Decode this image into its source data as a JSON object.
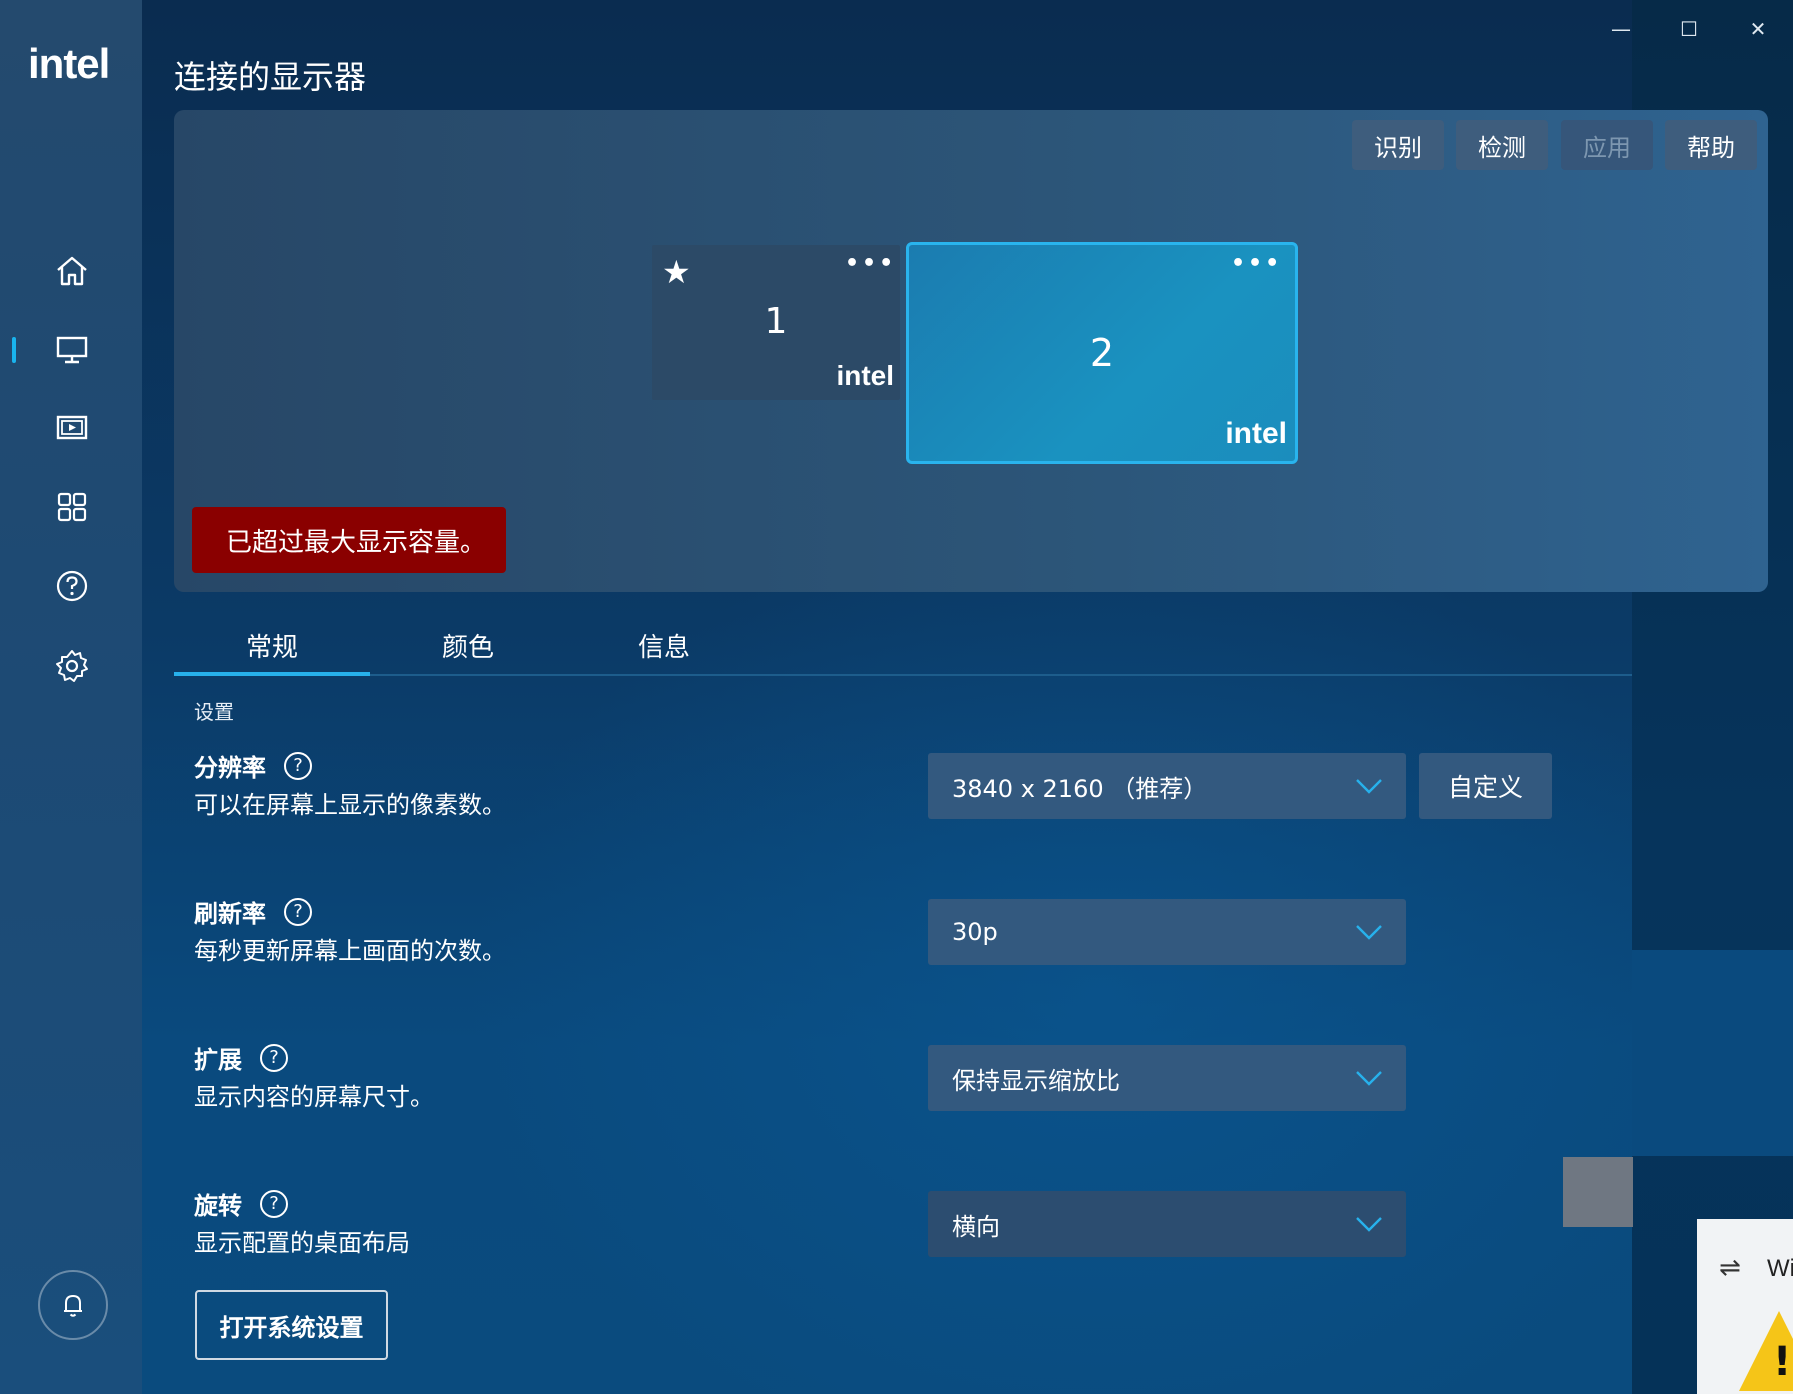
{
  "app": {
    "logo": "intel"
  },
  "window_controls": {
    "minimize": "—",
    "maximize": "☐",
    "close": "✕"
  },
  "page": {
    "title": "连接的显示器"
  },
  "toolbar": {
    "identify": "识别",
    "detect": "检测",
    "apply": "应用",
    "help": "帮助"
  },
  "monitors": [
    {
      "number": "1",
      "primary": true,
      "dots": "•••",
      "brand": "intel"
    },
    {
      "number": "2",
      "primary": false,
      "dots": "•••",
      "brand": "intel",
      "selected": true
    }
  ],
  "error": {
    "message": "已超过最大显示容量。"
  },
  "tabs": [
    {
      "label": "常规",
      "active": true
    },
    {
      "label": "颜色"
    },
    {
      "label": "信息"
    }
  ],
  "settings": {
    "section_label": "设置",
    "resolution": {
      "title": "分辨率",
      "desc": "可以在屏幕上显示的像素数。",
      "value": "3840 x 2160 （推荐）",
      "custom_label": "自定义"
    },
    "refresh": {
      "title": "刷新率",
      "desc": "每秒更新屏幕上画面的次数。",
      "value": "30p"
    },
    "scaling": {
      "title": "扩展",
      "desc": "显示内容的屏幕尺寸。",
      "value": "保持显示缩放比"
    },
    "rotation": {
      "title": "旋转",
      "desc": "显示配置的桌面布局",
      "value": "横向"
    },
    "open_system_settings": "打开系统设置"
  },
  "notification": {
    "text": "Wi",
    "icon": "usb-icon",
    "warning": "!"
  },
  "colors": {
    "accent": "#27b1ec",
    "error": "#8a0000"
  }
}
